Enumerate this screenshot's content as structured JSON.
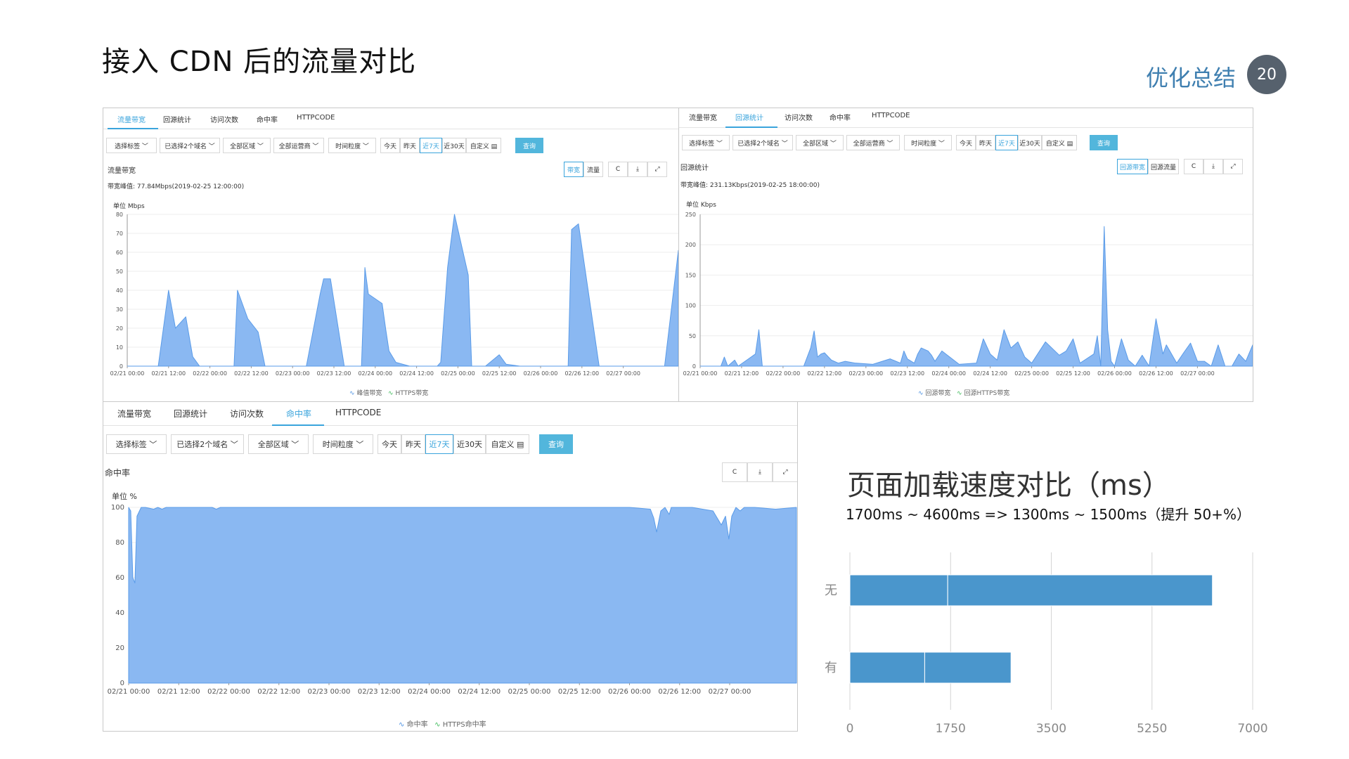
{
  "slide": {
    "title": "接入 CDN 后的流量对比",
    "section": "优化总结",
    "page": "20"
  },
  "panel1": {
    "tabs": [
      "流量带宽",
      "回源统计",
      "访问次数",
      "命中率",
      "HTTPCODE"
    ],
    "filters": [
      "选择标签 ﹀",
      "已选择2个域名 ﹀",
      "全部区域 ﹀",
      "全部运营商 ﹀",
      "时间粒度 ﹀",
      "今天",
      "昨天",
      "近7天",
      "近30天",
      "自定义 ▤"
    ],
    "query": "查询",
    "heading": "流量带宽",
    "toggle": [
      "带宽",
      "流量"
    ],
    "tool_icons": [
      "C",
      "⤓",
      "⤢"
    ],
    "peak": "带宽峰值: 77.84Mbps(2019-02-25 12:00:00)",
    "unit": "单位 Mbps",
    "legend": [
      "峰值带宽",
      "HTTPS带宽"
    ]
  },
  "panel2": {
    "tabs": [
      "流量带宽",
      "回源统计",
      "访问次数",
      "命中率",
      "HTTPCODE"
    ],
    "filters": [
      "选择标签 ﹀",
      "已选择2个域名 ﹀",
      "全部区域 ﹀",
      "全部运营商 ﹀",
      "时间粒度 ﹀",
      "今天",
      "昨天",
      "近7天",
      "近30天",
      "自定义 ▤"
    ],
    "query": "查询",
    "heading": "回源统计",
    "toggle": [
      "回源带宽",
      "回源流量"
    ],
    "tool_icons": [
      "C",
      "⤓",
      "⤢"
    ],
    "peak": "带宽峰值: 231.13Kbps(2019-02-25 18:00:00)",
    "unit": "单位 Kbps",
    "legend": [
      "回源带宽",
      "回源HTTPS带宽"
    ]
  },
  "panel3": {
    "tabs": [
      "流量带宽",
      "回源统计",
      "访问次数",
      "命中率",
      "HTTPCODE"
    ],
    "filters": [
      "选择标签 ﹀",
      "已选择2个域名 ﹀",
      "全部区域 ﹀",
      "时间粒度 ﹀",
      "今天",
      "昨天",
      "近7天",
      "近30天",
      "自定义 ▤"
    ],
    "query": "查询",
    "heading": "命中率",
    "tool_icons": [
      "C",
      "⤓",
      "⤢"
    ],
    "unit": "单位 %",
    "legend": [
      "命中率",
      "HTTPS命中率"
    ]
  },
  "comparison": {
    "title": "页面加载速度对比（ms）",
    "subtitle": "1700ms ~ 4600ms  =>  1300ms ~ 1500ms（提升 50+%）"
  },
  "chart_data": [
    {
      "type": "area",
      "name": "bandwidth",
      "ylabel": "单位 Mbps",
      "ylim": [
        0,
        80
      ],
      "yticks": [
        0,
        10,
        20,
        30,
        40,
        50,
        60,
        70,
        80
      ],
      "xticks": [
        "02/21 00:00",
        "02/21 12:00",
        "02/22 00:00",
        "02/22 12:00",
        "02/23 00:00",
        "02/23 12:00",
        "02/24 00:00",
        "02/24 12:00",
        "02/25 00:00",
        "02/25 12:00",
        "02/26 00:00",
        "02/26 12:00",
        "02/27 00:00"
      ],
      "x_hours": [
        0,
        9,
        12,
        14,
        17,
        19,
        21,
        25,
        26,
        31,
        32,
        35,
        38,
        40,
        44,
        45,
        50,
        52,
        56,
        57,
        59,
        63,
        66,
        68,
        69,
        70,
        74,
        75,
        76,
        78,
        82,
        86,
        90,
        91,
        93,
        95,
        99,
        100,
        104,
        106,
        108,
        110,
        114,
        120,
        128,
        129,
        131,
        133,
        137,
        139,
        142,
        144,
        148,
        151,
        153,
        156,
        160
      ],
      "series": [
        {
          "name": "峰值带宽",
          "color": "#8ab8f2",
          "values": [
            0,
            0,
            40,
            20,
            26,
            5,
            0,
            0,
            0,
            0,
            40,
            25,
            18,
            0,
            0,
            0,
            0,
            0,
            38,
            46,
            46,
            0,
            0,
            0,
            52,
            38,
            33,
            20,
            8,
            2,
            0,
            0,
            0,
            2,
            52,
            80,
            48,
            0,
            0,
            3,
            6,
            1,
            0,
            0,
            0,
            72,
            75,
            50,
            0,
            0,
            0,
            0,
            0,
            0,
            0,
            0,
            61
          ]
        },
        {
          "name": "HTTPS带宽",
          "color": "#3dbb5a",
          "values": []
        }
      ]
    },
    {
      "type": "area",
      "name": "origin-bandwidth",
      "ylabel": "单位 Kbps",
      "ylim": [
        0,
        250
      ],
      "yticks": [
        0,
        50,
        100,
        150,
        200,
        250
      ],
      "xticks": [
        "02/21 00:00",
        "02/21 12:00",
        "02/22 00:00",
        "02/22 12:00",
        "02/23 00:00",
        "02/23 12:00",
        "02/24 00:00",
        "02/24 12:00",
        "02/25 00:00",
        "02/25 12:00",
        "02/26 00:00",
        "02/26 12:00",
        "02/27 00:00"
      ],
      "x_hours": [
        0,
        6,
        7,
        8,
        10,
        11,
        14,
        16,
        17,
        18,
        30,
        32,
        33,
        34,
        35,
        36,
        38,
        40,
        42,
        45,
        50,
        55,
        58,
        59,
        60,
        62,
        63,
        64,
        66,
        67,
        68,
        70,
        75,
        80,
        82,
        84,
        86,
        88,
        90,
        92,
        94,
        96,
        100,
        104,
        106,
        108,
        110,
        114,
        115,
        116,
        117,
        118,
        119,
        120,
        122,
        124,
        126,
        128,
        130,
        132,
        134,
        135,
        136,
        138,
        140,
        142,
        144,
        146,
        148,
        150,
        152,
        154,
        156,
        158,
        160
      ],
      "series": [
        {
          "name": "回源带宽",
          "color": "#8ab8f2",
          "values": [
            0,
            0,
            15,
            0,
            10,
            0,
            12,
            20,
            60,
            0,
            0,
            30,
            58,
            15,
            20,
            22,
            10,
            5,
            8,
            5,
            3,
            12,
            5,
            25,
            12,
            5,
            20,
            30,
            25,
            18,
            8,
            25,
            3,
            5,
            45,
            20,
            10,
            60,
            30,
            40,
            15,
            5,
            40,
            18,
            25,
            45,
            5,
            20,
            50,
            0,
            230,
            60,
            8,
            0,
            45,
            10,
            0,
            18,
            0,
            78,
            20,
            35,
            25,
            5,
            22,
            38,
            8,
            8,
            0,
            35,
            0,
            0,
            20,
            8,
            35
          ]
        },
        {
          "name": "回源HTTPS带宽",
          "color": "#3dbb5a",
          "values": []
        }
      ]
    },
    {
      "type": "area",
      "name": "hit-rate",
      "ylabel": "单位 %",
      "ylim": [
        0,
        100
      ],
      "yticks": [
        0,
        20,
        40,
        60,
        80,
        100
      ],
      "xticks": [
        "02/21 00:00",
        "02/21 12:00",
        "02/22 00:00",
        "02/22 12:00",
        "02/23 00:00",
        "02/23 12:00",
        "02/24 00:00",
        "02/24 12:00",
        "02/25 00:00",
        "02/25 12:00",
        "02/26 00:00",
        "02/26 12:00",
        "02/27 00:00"
      ],
      "x_hours": [
        0,
        0.5,
        1,
        1.5,
        2,
        3,
        3.5,
        4,
        6,
        7,
        8,
        9,
        10,
        12,
        20,
        21,
        22,
        30,
        40,
        60,
        80,
        100,
        110,
        120,
        125,
        125.8,
        126.5,
        127.5,
        128.5,
        129.5,
        130,
        135,
        140,
        141,
        142,
        143,
        143.8,
        144.5,
        145.5,
        146.5,
        147.5,
        148.5,
        149.5,
        150,
        155,
        160
      ],
      "series": [
        {
          "name": "命中率",
          "color": "#8ab8f2",
          "values": [
            100,
            98,
            60,
            57,
            95,
            100,
            100,
            100,
            99,
            100,
            99,
            100,
            100,
            100,
            100,
            99,
            100,
            100,
            100,
            100,
            100,
            100,
            100,
            100,
            99,
            94,
            86,
            98,
            100,
            96,
            100,
            100,
            98,
            94,
            90,
            95,
            82,
            95,
            100,
            98,
            100,
            100,
            100,
            100,
            99,
            100
          ]
        },
        {
          "name": "HTTPS命中率",
          "color": "#3dbb5a",
          "values": []
        }
      ]
    },
    {
      "type": "bar",
      "name": "page-load",
      "orientation": "horizontal",
      "stacked": true,
      "categories": [
        "无",
        "有"
      ],
      "xlim": [
        0,
        7000
      ],
      "xticks": [
        0,
        1750,
        3500,
        5250,
        7000
      ],
      "series": [
        {
          "name": "min",
          "values": [
            1700,
            1300
          ]
        },
        {
          "name": "range",
          "values": [
            4600,
            1500
          ]
        }
      ],
      "color": "#4a96cc"
    }
  ]
}
